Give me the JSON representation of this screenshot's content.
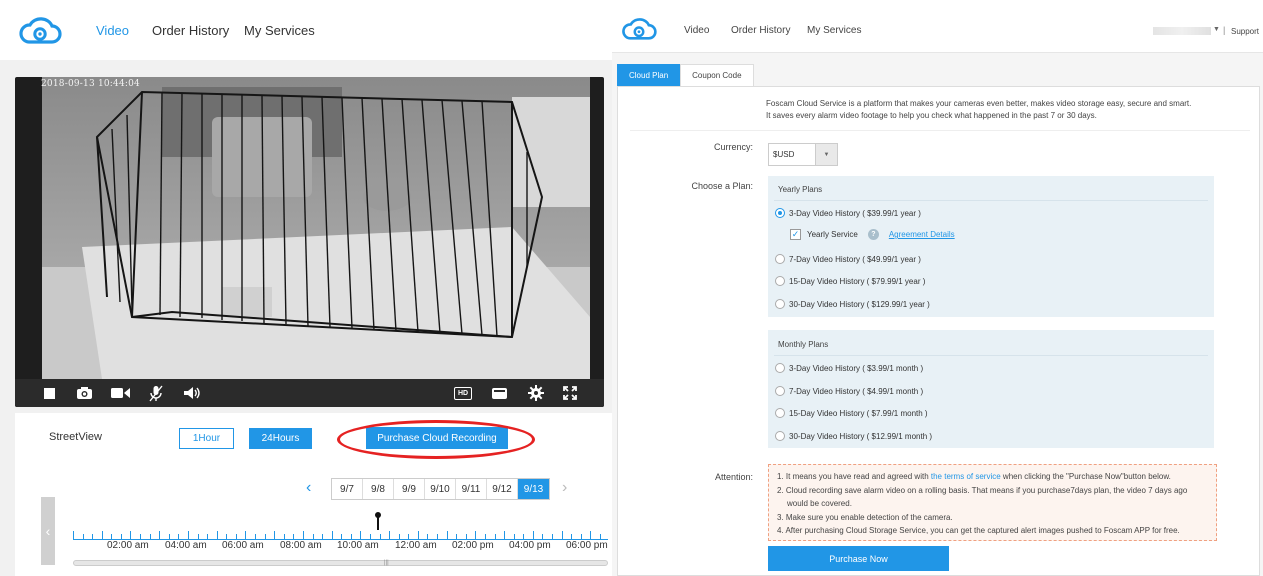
{
  "left": {
    "nav": [
      "Video",
      "Order History",
      "My Services"
    ],
    "video": {
      "timestamp": "2018-09-13 10:44:04"
    },
    "controls": {
      "hd_label": "HD"
    },
    "streetview_label": "StreetView",
    "range_buttons": [
      "1Hour",
      "24Hours"
    ],
    "purchase_cloud_label": "Purchase Cloud Recording",
    "dates": [
      "9/7",
      "9/8",
      "9/9",
      "9/10",
      "9/11",
      "9/12",
      "9/13"
    ],
    "active_date": "9/13",
    "timeline_labels": [
      "02:00 am",
      "04:00 am",
      "06:00 am",
      "08:00 am",
      "10:00 am",
      "12:00 am",
      "02:00 pm",
      "04:00 pm",
      "06:00 pm"
    ],
    "accent_color": "#2196e6",
    "highlight_color": "#e52222"
  },
  "right": {
    "nav": [
      "Video",
      "Order History",
      "My Services"
    ],
    "support_label": "Support",
    "separator": "|",
    "tabs": [
      "Cloud Plan",
      "Coupon Code"
    ],
    "intro": [
      "Foscam Cloud Service is a platform that makes your cameras even better, makes video storage easy, secure and smart.",
      "It saves every alarm video footage to help you check what happened in the past 7 or 30 days."
    ],
    "currency_label": "Currency:",
    "currency_value": "$USD",
    "plan_label": "Choose a Plan:",
    "yearly_title": "Yearly Plans",
    "yearly_plans": [
      "3-Day Video History ( $39.99/1 year )",
      "7-Day Video History ( $49.99/1 year )",
      "15-Day Video History ( $79.99/1 year )",
      "30-Day Video History ( $129.99/1 year )"
    ],
    "selected_plan": "3-Day Video History ( $39.99/1 year )",
    "yearly_service_label": "Yearly Service",
    "yearly_service_checked": true,
    "agreement_link": "Agreement Details",
    "monthly_title": "Monthly Plans",
    "monthly_plans": [
      "3-Day Video History ( $3.99/1 month )",
      "7-Day Video History ( $4.99/1 month )",
      "15-Day Video History ( $7.99/1 month )",
      "30-Day Video History ( $12.99/1 month )"
    ],
    "attention_label": "Attention:",
    "attention": {
      "item1_pre": "1. It means you have read and agreed with ",
      "item1_link": "the terms of service",
      "item1_post": " when clicking the \"Purchase Now\"button below.",
      "item2_line1": "2. Cloud recording save alarm video on a rolling basis. That means if you purchase7days plan, the video 7 days ago",
      "item2_line2": "would be covered.",
      "item3": "3. Make sure you enable detection of the camera.",
      "item4": "4. After purchasing Cloud Storage Service, you can get the captured alert images pushed to Foscam APP for free."
    },
    "purchase_now_label": "Purchase Now"
  }
}
